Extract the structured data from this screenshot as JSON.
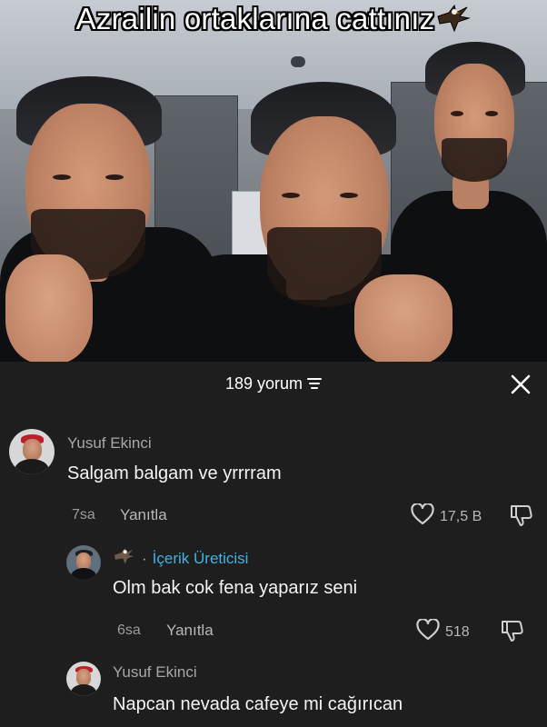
{
  "video": {
    "caption": "Azrailin ortaklarına cattınız",
    "caption_emoji_icon": "eagle-emoji-icon"
  },
  "comments_sheet": {
    "count_label": "189 yorum",
    "sort_icon": "sort-icon",
    "close_icon": "close-icon"
  },
  "comments": [
    {
      "username": "Yusuf Ekinci",
      "text": "Salgam balgam ve yrrrram",
      "time": "7sa",
      "reply_label": "Yanıtla",
      "likes": "17,5 B"
    },
    {
      "creator_badge": "İçerik Üreticisi",
      "creator_separator": "·",
      "text": "Olm bak cok fena yaparız seni",
      "time": "6sa",
      "reply_label": "Yanıtla",
      "likes": "518"
    },
    {
      "username": "Yusuf Ekinci",
      "text": "Napcan nevada cafeye mi cağırıcan"
    }
  ],
  "colors": {
    "sheet_background": "#1e1e1e",
    "creator_accent": "#38b6e4",
    "secondary_text": "#a8a8a8"
  }
}
